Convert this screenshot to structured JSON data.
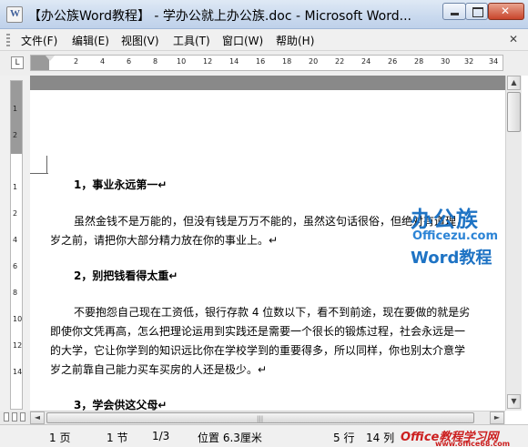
{
  "window": {
    "title": "【办公族Word教程】 - 学办公就上办公族.doc - Microsoft Word..."
  },
  "menu": {
    "items": [
      "文件(F)",
      "编辑(E)",
      "视图(V)",
      "工具(T)",
      "窗口(W)",
      "帮助(H)"
    ],
    "close_glyph": "✕"
  },
  "ruler": {
    "tab_glyph": "L",
    "numbers": [
      "2",
      "4",
      "6",
      "8",
      "10",
      "12",
      "14",
      "16",
      "18",
      "20",
      "22",
      "24",
      "26",
      "28",
      "30",
      "32",
      "34"
    ],
    "vertical_numbers": [
      "1",
      "2",
      "1",
      "2",
      "4",
      "6",
      "8",
      "10",
      "12",
      "14"
    ]
  },
  "document": {
    "heading1": "1，事业永远第一↵",
    "para1_line1": "虽然金钱不是万能的，但没有钱是万万不能的，虽然这句话很俗，但绝对有道理，",
    "para1_line2": "岁之前，请把你大部分精力放在你的事业上。↵",
    "heading2": "2，别把钱看得太重↵",
    "para2_line1": "不要抱怨自己现在工资低，银行存款 4 位数以下，看不到前途，现在要做的就是劣",
    "para2_line2": "即使你文凭再高，怎么把理论运用到实践还是需要一个很长的锻炼过程，社会永远是一",
    "para2_line3": "的大学，它让你学到的知识远比你在学校学到的重要得多，所以同样，你也别太介意学",
    "para2_line4": "岁之前靠自己能力买车买房的人还是极少。↵",
    "heading3": "3，学会供这父母↵"
  },
  "watermark": {
    "cn": "办公族",
    "url": "Officezu.com",
    "word": "Word教程"
  },
  "scrollbar": {
    "up": "▲",
    "down": "▼",
    "left": "◄",
    "right": "►",
    "grip": "|||"
  },
  "status": {
    "page": "1 页",
    "section": "1  节",
    "page_of": "1/3",
    "position": "位置 6.3厘米",
    "row": "5 行",
    "col": "14 列",
    "logo": "Office教程学习网",
    "logo_sub": "www.office68.com"
  }
}
